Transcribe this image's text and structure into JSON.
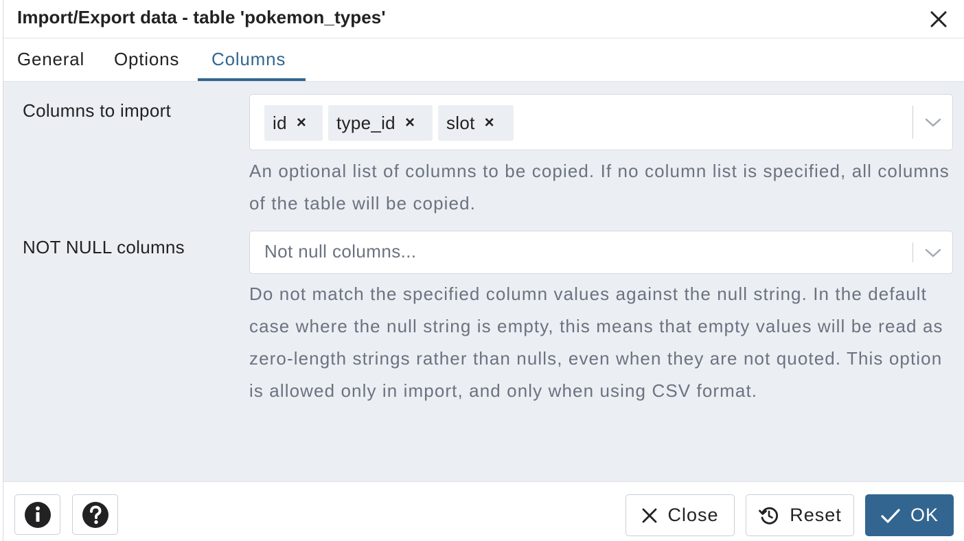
{
  "dialog": {
    "title": "Import/Export data - table 'pokemon_types'"
  },
  "tabs": [
    {
      "label": "General",
      "active": false
    },
    {
      "label": "Options",
      "active": false
    },
    {
      "label": "Columns",
      "active": true
    }
  ],
  "columns_to_import": {
    "label": "Columns to import",
    "selected": [
      "id",
      "type_id",
      "slot"
    ],
    "remove_glyph": "×",
    "help": "An optional list of columns to be copied. If no column list is specified, all columns of the table will be copied."
  },
  "not_null_columns": {
    "label": "NOT NULL columns",
    "placeholder": "Not null columns...",
    "help": "Do not match the specified column values against the null string. In the default case where the null string is empty, this means that empty values will be read as zero-length strings rather than nulls, even when they are not quoted. This option is allowed only in import, and only when using CSV format."
  },
  "footer": {
    "info_icon": "info-icon",
    "help_icon": "help-icon",
    "close_label": "Close",
    "reset_label": "Reset",
    "ok_label": "OK"
  },
  "colors": {
    "accent": "#326690",
    "panel_bg": "#ebeff3",
    "muted_text": "#6b7280"
  }
}
